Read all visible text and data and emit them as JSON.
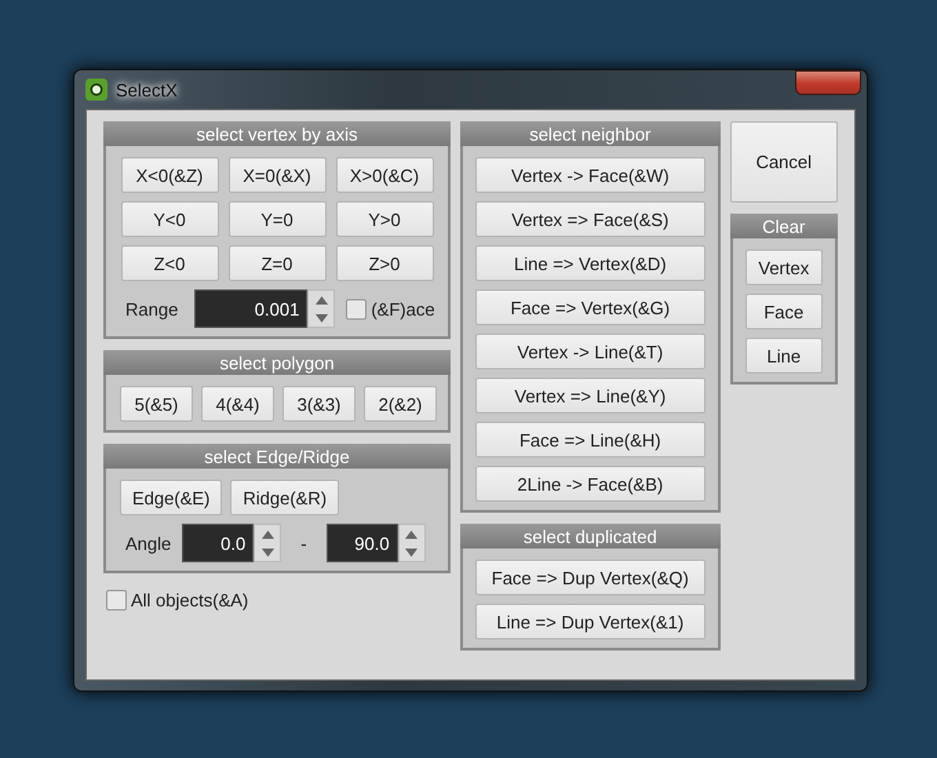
{
  "window": {
    "title": "SelectX"
  },
  "vertex_axis": {
    "title": "select vertex by axis",
    "buttons": [
      "X<0(&Z)",
      "X=0(&X)",
      "X>0(&C)",
      "Y<0",
      "Y=0",
      "Y>0",
      "Z<0",
      "Z=0",
      "Z>0"
    ],
    "range": {
      "label": "Range",
      "value": "0.001"
    },
    "face_option": {
      "label": "(&F)ace",
      "checked": false
    }
  },
  "polygon": {
    "title": "select polygon",
    "buttons": [
      "5(&5)",
      "4(&4)",
      "3(&3)",
      "2(&2)"
    ]
  },
  "edge_ridge": {
    "title": "select Edge/Ridge",
    "buttons": [
      "Edge(&E)",
      "Ridge(&R)"
    ],
    "angle": {
      "label": "Angle",
      "min": "0.0",
      "separator": "-",
      "max": "90.0"
    }
  },
  "all_objects": {
    "label": "All objects(&A)",
    "checked": false
  },
  "neighbor": {
    "title": "select neighbor",
    "buttons": [
      "Vertex -> Face(&W)",
      "Vertex => Face(&S)",
      "Line => Vertex(&D)",
      "Face => Vertex(&G)",
      "Vertex -> Line(&T)",
      "Vertex => Line(&Y)",
      "Face => Line(&H)",
      "2Line -> Face(&B)"
    ]
  },
  "duplicated": {
    "title": "select duplicated",
    "buttons": [
      "Face => Dup Vertex(&Q)",
      "Line => Dup Vertex(&1)"
    ]
  },
  "cancel_button": "Cancel",
  "clear": {
    "title": "Clear",
    "buttons": [
      "Vertex",
      "Face",
      "Line"
    ]
  }
}
